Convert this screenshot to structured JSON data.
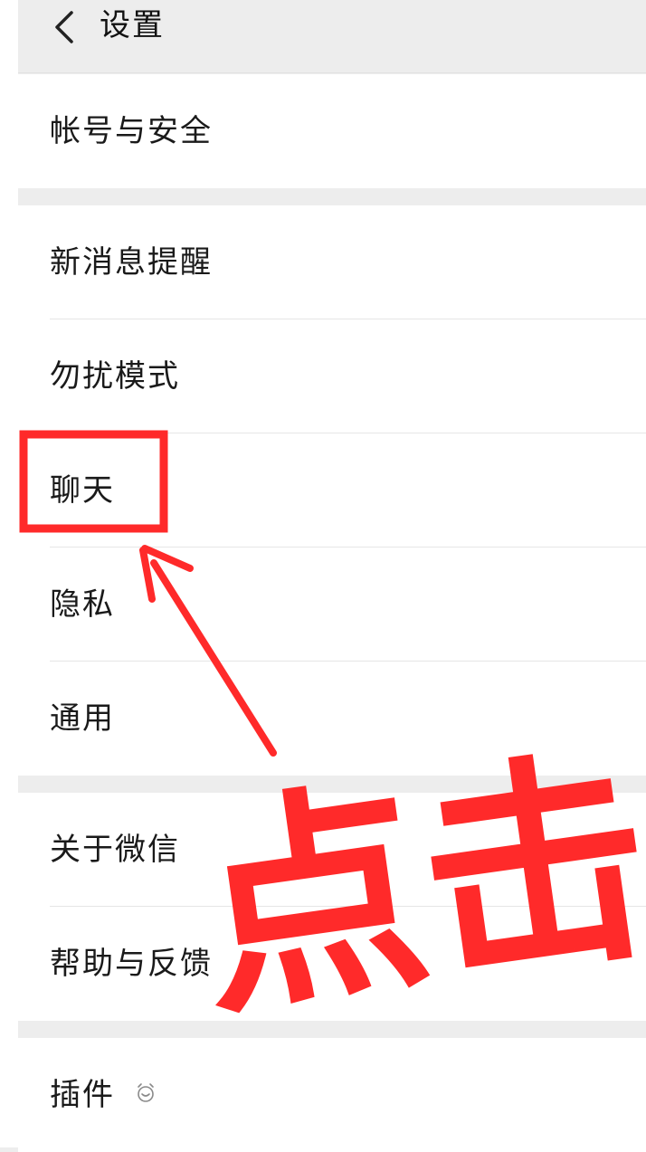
{
  "header": {
    "title": "设置",
    "back_icon": "chevron-left-icon"
  },
  "groups": [
    {
      "items": [
        "帐号与安全"
      ]
    },
    {
      "items": [
        "新消息提醒",
        "勿扰模式",
        "聊天",
        "隐私",
        "通用"
      ]
    },
    {
      "items": [
        "关于微信",
        "帮助与反馈"
      ]
    },
    {
      "items": [
        "插件"
      ]
    }
  ],
  "plugin_badge_icon": "plugin-badge-icon",
  "annotation": {
    "text": "点击",
    "highlight_target": "聊天",
    "color": "#ff2a2a"
  }
}
